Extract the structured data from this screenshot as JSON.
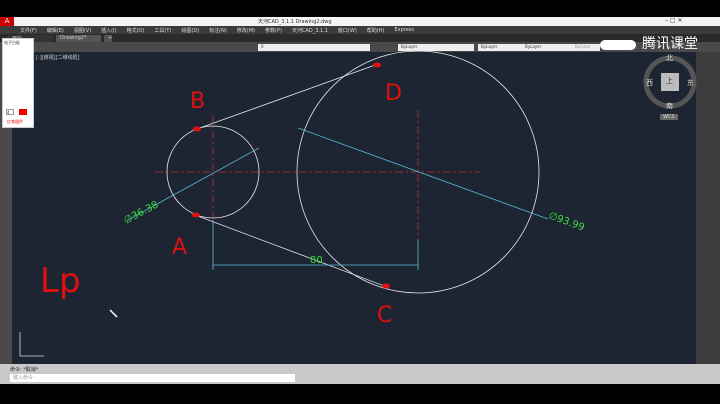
{
  "title": "天河CAD_3.1.1    Drawing2.dwg",
  "menu": [
    "文件(F)",
    "编辑(E)",
    "视图(V)",
    "插入(I)",
    "格式(O)",
    "工具(T)",
    "绘图(D)",
    "标注(N)",
    "修改(M)",
    "参数(P)",
    "天河CAD_3.1.1",
    "窗口(W)",
    "帮助(H)",
    "Express"
  ],
  "tabs": [
    "开始",
    "Drawing2*"
  ],
  "toolbar": {
    "layer": "0",
    "color": "ByLayer",
    "linetype": "ByLayer",
    "lineweight": "ByLayer",
    "plot": "ByColor"
  },
  "viewport_label": "[-][俯视][二维线框]",
  "whiteboard": {
    "title": "电子白板",
    "size": "4",
    "footer": "红笔粗件"
  },
  "viewcube": {
    "top": "上",
    "north": "北",
    "south": "南",
    "east": "东",
    "west": "西",
    "wcs": "WCS"
  },
  "brand": "腾讯课堂",
  "drawing": {
    "dim_small": "∅36.38",
    "dim_big": "∅93.99",
    "dim_linear": "80",
    "labels": {
      "a": "A",
      "b": "B",
      "c": "C",
      "d": "D",
      "lp": "Lp"
    }
  },
  "command": {
    "history": "命令: *取消*",
    "placeholder": "键入命令"
  },
  "colors": {
    "canvas": "#1e2532",
    "geometry": "#e8e8e8",
    "center": "#c03030",
    "dimension": "#5ab8d8",
    "dim_text": "#3adf3a",
    "annotation": "#e01010"
  }
}
